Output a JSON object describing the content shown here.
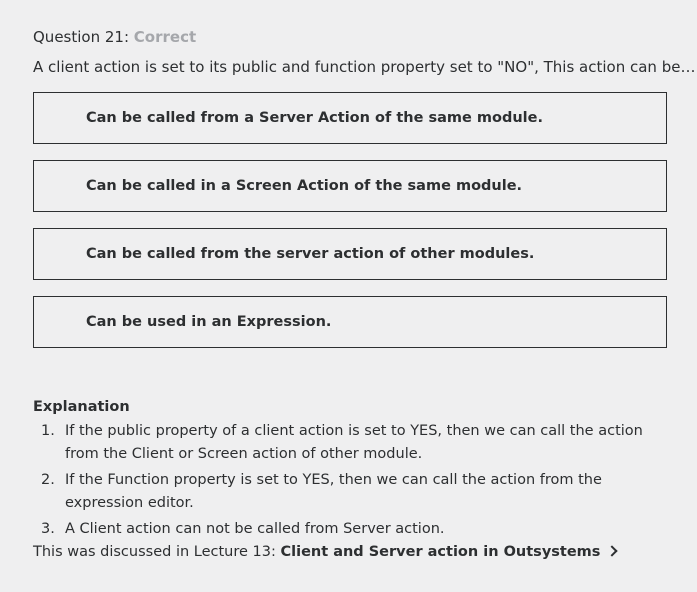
{
  "question": {
    "label": "Question 21:",
    "status": "Correct",
    "prompt": "A client action is set to its public and function property set to \"NO\", This action can be…."
  },
  "answers": [
    {
      "label": "Can be called from a Server Action of the same module."
    },
    {
      "label": "Can be called in a Screen Action of the same module."
    },
    {
      "label": "Can be called from the server action of other modules."
    },
    {
      "label": "Can be used in an Expression."
    }
  ],
  "explanation": {
    "title": "Explanation",
    "items": [
      {
        "num": "1.",
        "text": "If the public property of a client action is set to YES, then we can call the action from the Client or Screen action of other module."
      },
      {
        "num": "2.",
        "text": "If the Function property is set to YES, then we can call the action from the expression editor."
      },
      {
        "num": "3.",
        "text": "A Client action can not be called from Server action."
      }
    ],
    "lecture_prefix": "This was discussed in Lecture 13: ",
    "lecture_link": "Client and Server action in Outsystems"
  },
  "icons": {
    "lecture_link_icon": "chevron-right-icon"
  }
}
